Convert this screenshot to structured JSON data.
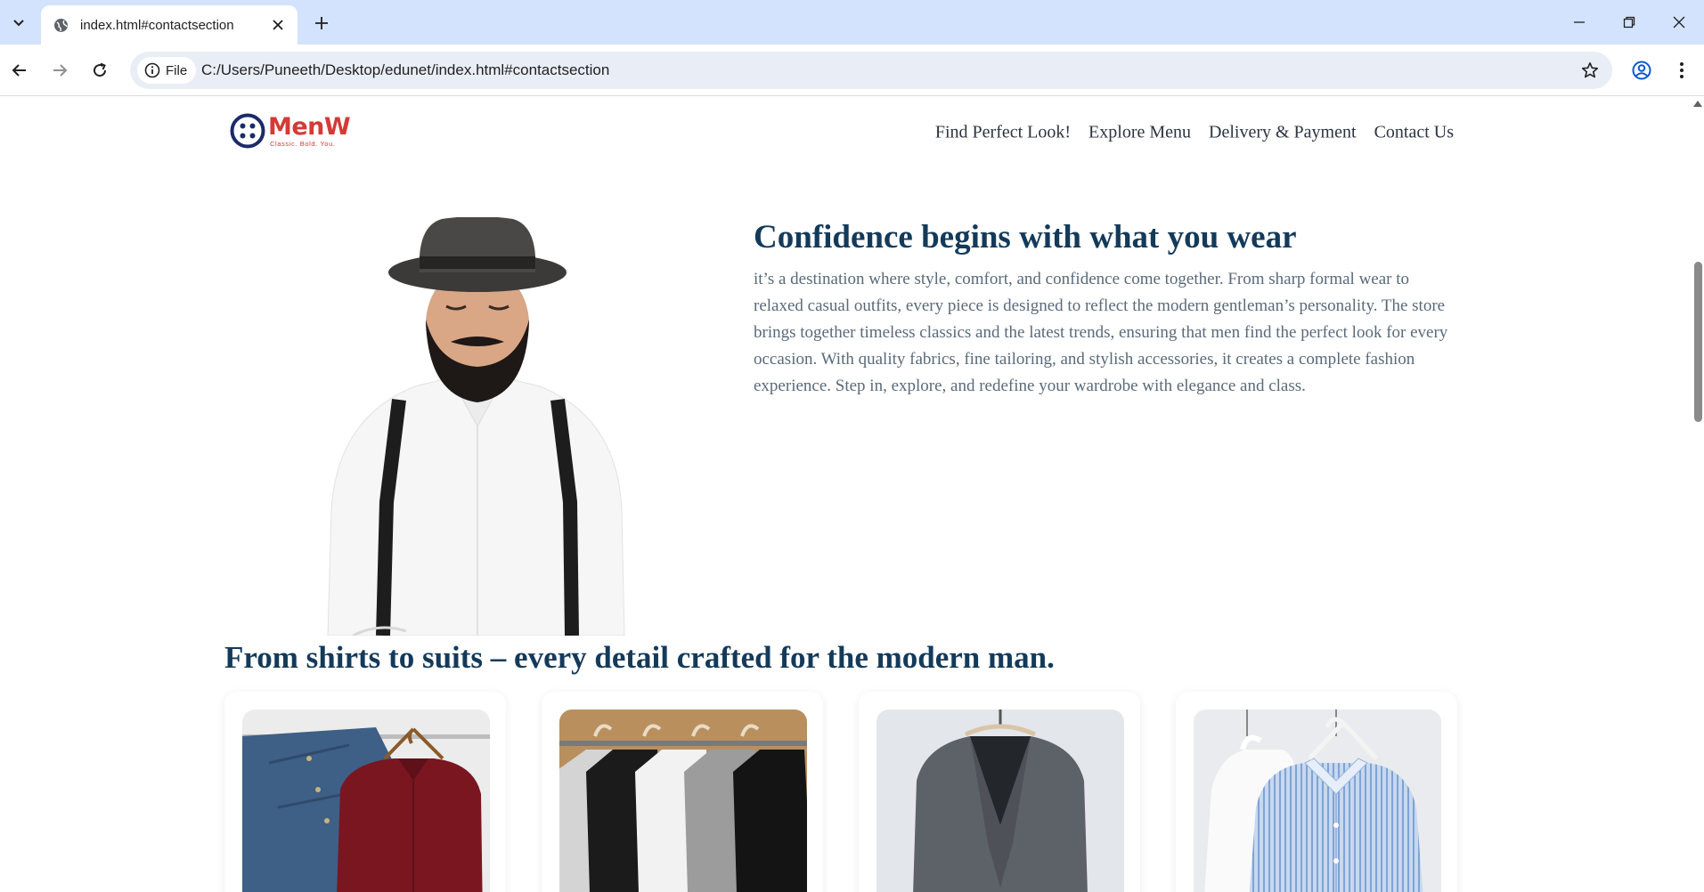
{
  "browser": {
    "tab_title": "index.html#contactsection",
    "site_chip_label": "File",
    "url": "C:/Users/Puneeth/Desktop/edunet/index.html#contactsection"
  },
  "site": {
    "logo": {
      "name": "MenW",
      "tagline": "Classic. Bold. You."
    },
    "nav": [
      "Find Perfect Look!",
      "Explore Menu",
      "Delivery & Payment",
      "Contact Us"
    ],
    "hero": {
      "title": "Confidence begins with what you wear",
      "body": "it’s a destination where style, comfort, and confidence come together. From sharp formal wear to relaxed casual outfits, every piece is designed to reflect the modern gentleman’s personality. The store brings together timeless classics and the latest trends, ensuring that men find the perfect look for every occasion. With quality fabrics, fine tailoring, and stylish accessories, it creates a complete fashion experience. Step in, explore, and redefine your wardrobe with elegance and class."
    },
    "products": {
      "title": "From shirts to suits – every detail crafted for the modern man.",
      "cards": [
        {
          "image": "shirts-on-hanger"
        },
        {
          "image": "tshirts-on-rack"
        },
        {
          "image": "grey-blazer"
        },
        {
          "image": "striped-shirts"
        }
      ]
    }
  },
  "colors": {
    "accent": "#d43a36",
    "heading": "#143a5a",
    "body_text": "#5a6a7a",
    "chrome": "#d3e3fd"
  }
}
